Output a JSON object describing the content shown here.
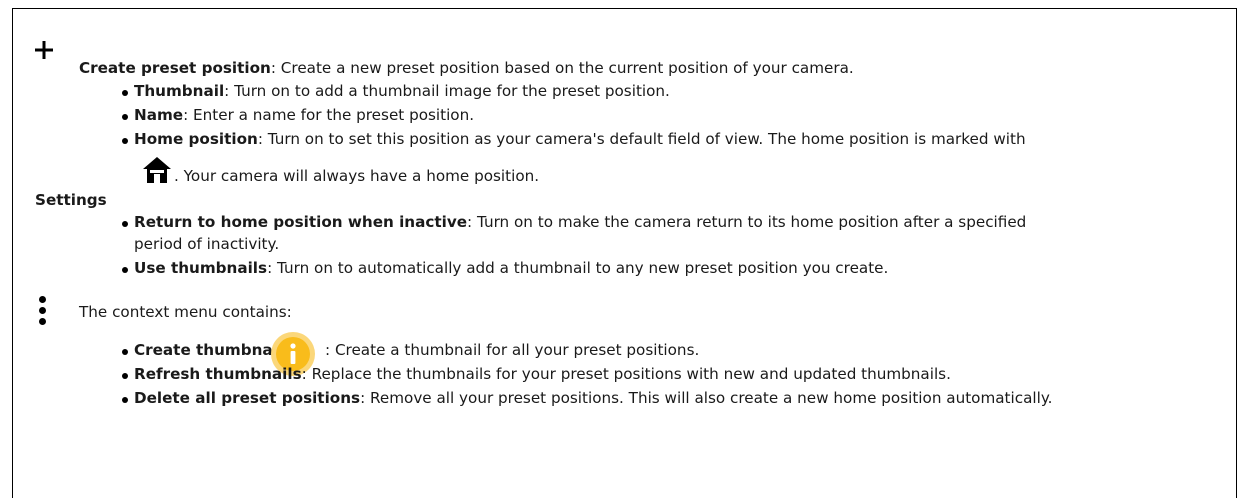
{
  "create_preset": {
    "icon": "plus-icon",
    "label": "Create preset position",
    "sep": ":",
    "text": " Create a new preset position based on the current position of your camera.",
    "items": [
      {
        "label": "Thumbnail",
        "sep": ":",
        "text": " Turn on to add a thumbnail image for the preset position."
      },
      {
        "label": "Name",
        "sep": ":",
        "text": " Enter a name for the preset position."
      },
      {
        "label": "Home position",
        "sep": ":",
        "text": " Turn on to set this position as your camera's default field of view. The home position is marked with"
      }
    ],
    "home_icon": "home-icon",
    "home_cont": ". Your camera will always have a home position."
  },
  "settings": {
    "heading": "Settings",
    "items": [
      {
        "label": "Return to home position when inactive",
        "sep": ":",
        "text": " Turn on to make the camera return to its home position after a specified",
        "cont": "period of inactivity."
      },
      {
        "label": "Use thumbnails",
        "sep": ":",
        "text": " Turn on to automatically add a thumbnail to any new preset position you create."
      }
    ]
  },
  "context_menu": {
    "icon": "kebab-icon",
    "intro": "The context menu contains:",
    "items": [
      {
        "label": "Create thumbnails",
        "icon": "info-icon",
        "text": ": Create a thumbnail for all your preset positions."
      },
      {
        "label": "Refresh thumbnails",
        "sep": ":",
        "text": " Replace the thumbnails for your preset positions with new and updated thumbnails."
      },
      {
        "label": "Delete all preset positions",
        "sep": ":",
        "text": " Remove all your preset positions. This will also create a new home position automatically."
      }
    ]
  },
  "colors": {
    "info_icon_fill": "#f9bc1b",
    "info_icon_ring": "#fbd77a",
    "text": "#1a1a1a"
  }
}
